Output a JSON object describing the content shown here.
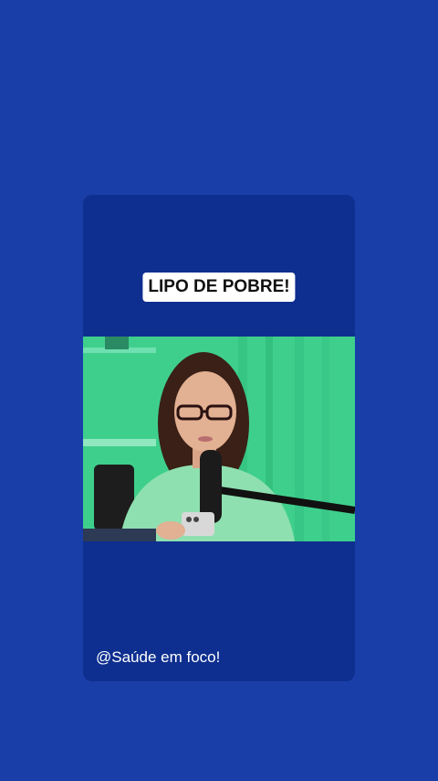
{
  "post": {
    "caption": "LIPO DE POBRE!",
    "handle": "@Saúde em foco!"
  },
  "colors": {
    "background": "#1a3ea8",
    "card": "#0e2f8f",
    "caption_bg": "#ffffff"
  }
}
